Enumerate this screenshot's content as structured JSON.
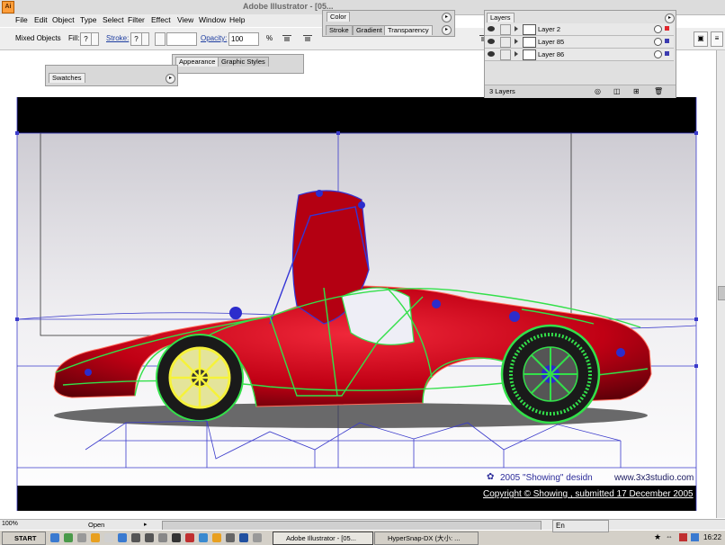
{
  "window": {
    "title": "Adobe Illustrator - [05..."
  },
  "app_icon": {
    "label": "Ai"
  },
  "menu": [
    {
      "label": "File"
    },
    {
      "label": "Edit"
    },
    {
      "label": "Object"
    },
    {
      "label": "Type"
    },
    {
      "label": "Select"
    },
    {
      "label": "Filter"
    },
    {
      "label": "Effect"
    },
    {
      "label": "View"
    },
    {
      "label": "Window"
    },
    {
      "label": "Help"
    }
  ],
  "controlbar": {
    "selection": "Mixed Objects",
    "fill_label": "Fill:",
    "stroke_label": "Stroke:",
    "unknown": "?",
    "opacity_label": "Opacity:",
    "opacity_value": "100",
    "opacity_unit": "%"
  },
  "color_panel": {
    "tabs": [
      "Color",
      "Stroke",
      "Gradient",
      "Transparency"
    ]
  },
  "appearance_panel": {
    "tabs": [
      "Appearance",
      "Graphic Styles"
    ]
  },
  "swatches_panel": {
    "tabs": [
      "Swatches"
    ]
  },
  "layers_panel": {
    "title": "Layers",
    "rows": [
      {
        "name": "Layer 2",
        "color": "#e0262c"
      },
      {
        "name": "Layer 85",
        "color": "#3b3bb0"
      },
      {
        "name": "Layer 86",
        "color": "#3b3bb0"
      }
    ],
    "footer": "3 Layers"
  },
  "artwork": {
    "credit1": "2005 \"Showing\" desidn",
    "credit2": "www.3x3studio.com",
    "copyright": "Copyright ©  Showing , submitted 17 December 2005"
  },
  "statusbar": {
    "zoom": "100%",
    "open_label": "Open"
  },
  "taskbar": {
    "start": "START",
    "tasks": [
      {
        "label": "Adobe Illustrator - [05..."
      },
      {
        "label": "HyperSnap-DX (大小: ..."
      }
    ],
    "lang": "En",
    "time": "16:22"
  },
  "colors": {
    "accent_red": "#d40016",
    "wire_green": "#33e04a",
    "wire_blue": "#2c2ccc",
    "wire_yellow": "#f6f23a"
  }
}
